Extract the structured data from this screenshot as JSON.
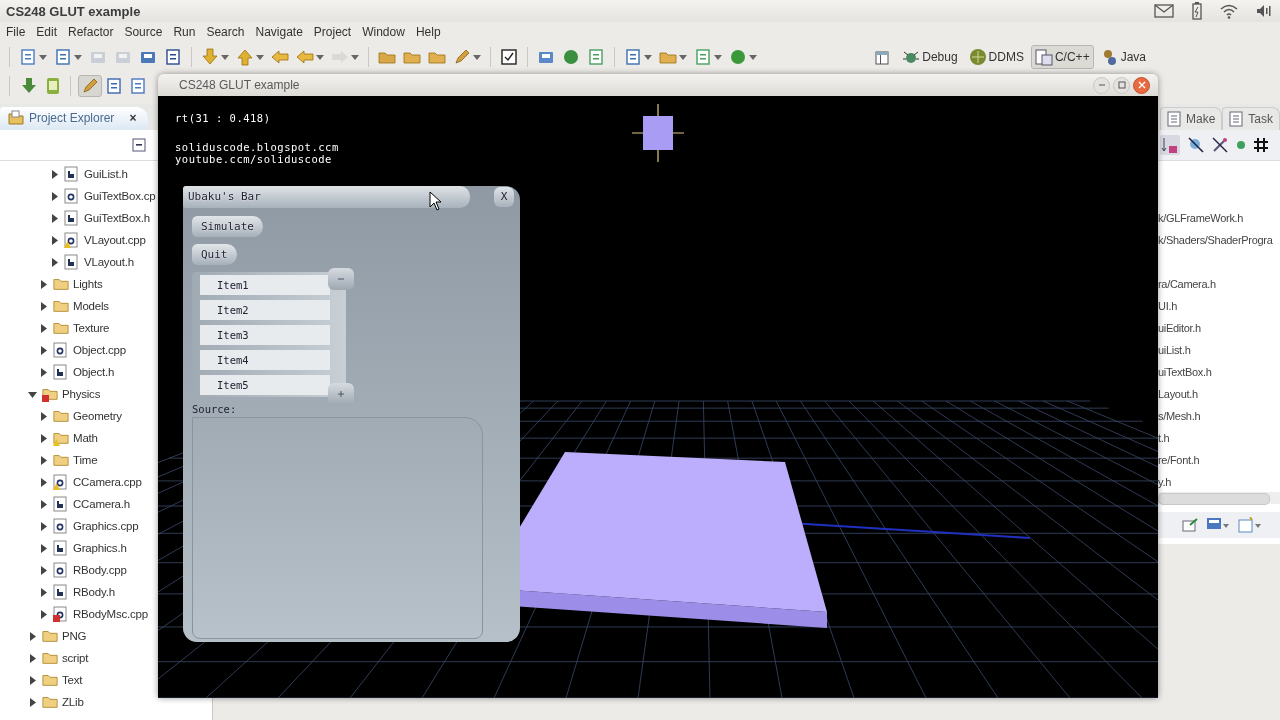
{
  "top_bar": {
    "title": "CS248 GLUT example"
  },
  "menu": [
    "File",
    "Edit",
    "Refactor",
    "Source",
    "Run",
    "Search",
    "Navigate",
    "Project",
    "Window",
    "Help"
  ],
  "toolbar_groups": [
    [
      {
        "kind": "newfile",
        "dropdown": true,
        "disabled": false,
        "on": false
      },
      {
        "kind": "newclass",
        "dropdown": true,
        "disabled": false,
        "on": false
      },
      {
        "kind": "save",
        "dropdown": false,
        "disabled": true,
        "on": false
      },
      {
        "kind": "saveall",
        "dropdown": false,
        "disabled": true,
        "on": false
      },
      {
        "kind": "print",
        "dropdown": false,
        "disabled": false,
        "on": false
      },
      {
        "kind": "binary",
        "dropdown": false,
        "disabled": false,
        "on": false
      }
    ],
    [
      {
        "kind": "down",
        "dropdown": true,
        "disabled": false,
        "on": false
      },
      {
        "kind": "up",
        "dropdown": true,
        "disabled": false,
        "on": false
      },
      {
        "kind": "pointer",
        "dropdown": false,
        "disabled": false,
        "on": false
      },
      {
        "kind": "back",
        "dropdown": true,
        "disabled": false,
        "on": false
      },
      {
        "kind": "forward",
        "dropdown": true,
        "disabled": true,
        "on": false
      }
    ],
    [
      {
        "kind": "openfolder",
        "dropdown": false,
        "disabled": false,
        "on": false
      },
      {
        "kind": "folder",
        "dropdown": false,
        "disabled": false,
        "on": false
      },
      {
        "kind": "folder",
        "dropdown": false,
        "disabled": false,
        "on": false
      },
      {
        "kind": "brush",
        "dropdown": true,
        "disabled": false,
        "on": false
      }
    ],
    [
      {
        "kind": "check",
        "dropdown": false,
        "disabled": false,
        "on": false
      }
    ],
    [
      {
        "kind": "package",
        "dropdown": false,
        "disabled": false,
        "on": false
      },
      {
        "kind": "junit",
        "dropdown": false,
        "disabled": false,
        "on": false
      },
      {
        "kind": "classfile",
        "dropdown": false,
        "disabled": false,
        "on": false
      }
    ],
    [
      {
        "kind": "newclass",
        "dropdown": true,
        "disabled": false,
        "on": false
      },
      {
        "kind": "folder",
        "dropdown": true,
        "disabled": false,
        "on": false
      },
      {
        "kind": "classfile",
        "dropdown": true,
        "disabled": false,
        "on": false
      },
      {
        "kind": "run",
        "dropdown": true,
        "disabled": false,
        "on": false
      }
    ]
  ],
  "toolbar2_groups": [
    [
      {
        "kind": "install",
        "dropdown": false,
        "disabled": false,
        "on": false
      },
      {
        "kind": "device",
        "dropdown": false,
        "disabled": false,
        "on": false
      }
    ],
    [
      {
        "kind": "brush",
        "dropdown": false,
        "disabled": false,
        "on": true
      },
      {
        "kind": "outline",
        "dropdown": false,
        "disabled": false,
        "on": false
      },
      {
        "kind": "paragraph",
        "dropdown": false,
        "disabled": false,
        "on": false
      }
    ]
  ],
  "perspectives": [
    {
      "label": "Debug",
      "kind": "bug",
      "selected": false
    },
    {
      "label": "DDMS",
      "kind": "ddms",
      "selected": false
    },
    {
      "label": "C/C++",
      "kind": "cpp",
      "selected": true
    },
    {
      "label": "Java",
      "kind": "java",
      "selected": false
    }
  ],
  "project_explorer": {
    "tab": {
      "label": "Project Explorer",
      "selected": true,
      "close": "×"
    },
    "tree": [
      {
        "children": [
          {
            "children": [
              {
                "label": "GuiList.h",
                "kind": "header",
                "expanded": false,
                "warning": false,
                "error": false
              },
              {
                "label": "GuiTextBox.cp",
                "kind": "source",
                "expanded": false,
                "warning": false,
                "error": false
              },
              {
                "label": "GuiTextBox.h",
                "kind": "header",
                "expanded": false,
                "warning": false,
                "error": false
              },
              {
                "label": "VLayout.cpp",
                "kind": "source",
                "expanded": false,
                "warning": true,
                "error": false
              },
              {
                "label": "VLayout.h",
                "kind": "header",
                "expanded": false,
                "warning": false,
                "error": false
              }
            ]
          },
          {
            "label": "Lights",
            "kind": "folder",
            "expanded": false,
            "warning": false,
            "error": false
          },
          {
            "label": "Models",
            "kind": "folder",
            "expanded": false,
            "warning": false,
            "error": false
          },
          {
            "label": "Texture",
            "kind": "folder",
            "expanded": false,
            "warning": false,
            "error": false
          },
          {
            "label": "Object.cpp",
            "kind": "source",
            "expanded": false,
            "warning": false,
            "error": false
          },
          {
            "label": "Object.h",
            "kind": "header",
            "expanded": false,
            "warning": false,
            "error": false
          }
        ]
      },
      {
        "label": "Physics",
        "kind": "folder",
        "expanded": true,
        "warning": false,
        "error": true,
        "children": [
          {
            "label": "Geometry",
            "kind": "folder",
            "expanded": false,
            "warning": false,
            "error": false
          },
          {
            "label": "Math",
            "kind": "folder",
            "expanded": false,
            "warning": true,
            "error": false
          },
          {
            "label": "Time",
            "kind": "folder",
            "expanded": false,
            "warning": false,
            "error": false
          },
          {
            "label": "CCamera.cpp",
            "kind": "source",
            "expanded": false,
            "warning": true,
            "error": false
          },
          {
            "label": "CCamera.h",
            "kind": "header",
            "expanded": false,
            "warning": false,
            "error": false
          },
          {
            "label": "Graphics.cpp",
            "kind": "source",
            "expanded": false,
            "warning": false,
            "error": false
          },
          {
            "label": "Graphics.h",
            "kind": "header",
            "expanded": false,
            "warning": false,
            "error": false
          },
          {
            "label": "RBody.cpp",
            "kind": "source",
            "expanded": false,
            "warning": false,
            "error": false
          },
          {
            "label": "RBody.h",
            "kind": "header",
            "expanded": false,
            "warning": false,
            "error": false
          },
          {
            "label": "RBodyMsc.cpp",
            "kind": "source",
            "expanded": false,
            "warning": false,
            "error": true
          }
        ]
      },
      {
        "label": "PNG",
        "kind": "folder",
        "expanded": false,
        "warning": false,
        "error": false
      },
      {
        "label": "script",
        "kind": "folder",
        "expanded": false,
        "warning": false,
        "error": false
      },
      {
        "label": "Text",
        "kind": "folder",
        "expanded": false,
        "warning": false,
        "error": false
      },
      {
        "label": "ZLib",
        "kind": "folder",
        "expanded": false,
        "warning": false,
        "error": false
      }
    ]
  },
  "glut_window": {
    "title": "CS248 GLUT example",
    "stats": "rt(31 : 0.418)",
    "credits": [
      "soliduscode.blogspot.ccm",
      "youtube.ccm/soliduscode"
    ],
    "gui_panel": {
      "title": "Ubaku's Bar",
      "close": "X",
      "buttons": [
        "Simulate",
        "Quit"
      ],
      "list_items": [
        "Item1",
        "Item2",
        "Item3",
        "Item4",
        "Item5"
      ],
      "source_label": "Source:"
    }
  },
  "right_panel": {
    "tabs": [
      {
        "label": "Make",
        "selected": false
      },
      {
        "label": "Task",
        "selected": false
      }
    ],
    "outline_groups": [
      [
        "k/GLFrameWork.h",
        "k/Shaders/ShaderProgra"
      ],
      [
        "ra/Camera.h",
        "UI.h",
        "uiEditor.h",
        "uiList.h",
        "uiTextBox.h",
        "Layout.h",
        "s/Mesh.h",
        "t.h",
        "re/Font.h",
        "y.h"
      ]
    ]
  }
}
